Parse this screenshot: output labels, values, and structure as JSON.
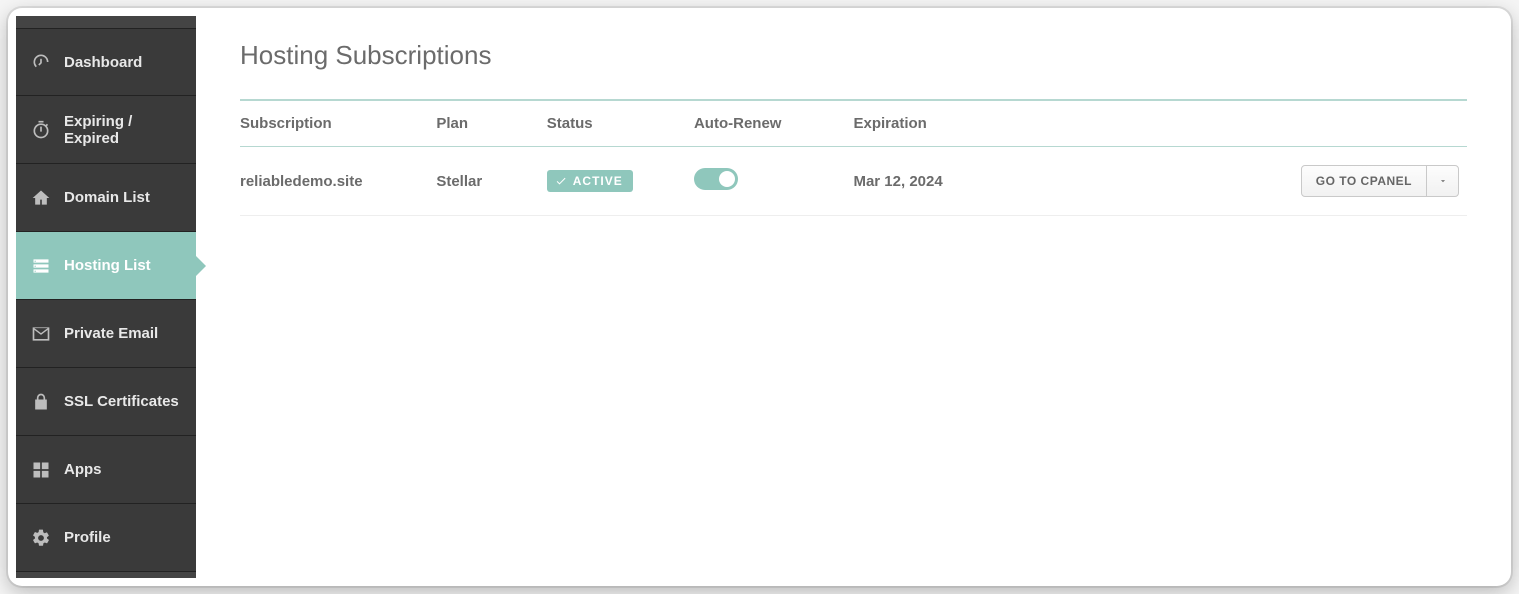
{
  "sidebar": {
    "items": [
      {
        "label": "Dashboard"
      },
      {
        "label": "Expiring / Expired"
      },
      {
        "label": "Domain List"
      },
      {
        "label": "Hosting List"
      },
      {
        "label": "Private Email"
      },
      {
        "label": "SSL Certificates"
      },
      {
        "label": "Apps"
      },
      {
        "label": "Profile"
      }
    ]
  },
  "page": {
    "title": "Hosting Subscriptions"
  },
  "table": {
    "headers": {
      "subscription": "Subscription",
      "plan": "Plan",
      "status": "Status",
      "autorenew": "Auto-Renew",
      "expiration": "Expiration"
    },
    "rows": [
      {
        "subscription": "reliabledemo.site",
        "plan": "Stellar",
        "status_label": "ACTIVE",
        "autorenew": true,
        "expiration": "Mar 12, 2024",
        "action_label": "GO TO CPANEL"
      }
    ]
  },
  "colors": {
    "accent": "#8fc7bc",
    "sidebar_bg": "#3a3a3a"
  }
}
